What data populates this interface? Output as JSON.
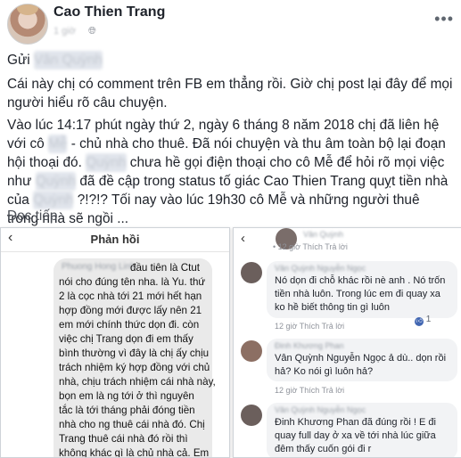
{
  "header": {
    "author": "Cao Thien Trang",
    "time": "1 giờ",
    "globe_icon": "globe-icon",
    "more_label": "•••"
  },
  "post": {
    "greeting": "Gửi",
    "greeting_name": "Vân Quỳnh",
    "para1": "Cái này chị có comment trên FB em thẳng rồi. Giờ chị post lại đây để mọi người hiểu rõ câu chuyện.",
    "para2_a": "Vào lúc 14:17 phút ngày thứ 2, ngày 6 tháng 8 năm 2018 chị đã liên hệ với cô",
    "hidden_1": "Mễ",
    "para2_b": "- chủ nhà cho thuê. Đã nói chuyện và thu âm toàn bộ lại đoạn hội thoại đó.",
    "hidden_2": "Quỳnh",
    "para2_c": "chưa hề gọi điện thoại cho cô Mễ để hỏi rõ mọi việc như",
    "hidden_3": "Quỳnh",
    "para2_d": "đã đề cập trong status tố giác Cao Thien Trang quỵt tiền nhà của",
    "hidden_4": "Quỳnh",
    "para2_e": "?!?!? Tối nay vào lúc 19h30 cô Mễ và những người thuê trong nhà sẽ ngồi ...",
    "see_more": "Đọc tiếp"
  },
  "left_shot": {
    "title": "Phản hồi",
    "back_label": "‹",
    "sender": "Phuong Hong Linh",
    "lines": [
      "đầu tiên là Ctut",
      "nói cho đúng tên nha. là Yu. thứ",
      "2 là cọc nhà tới 21 mới hết hạn",
      "hợp đồng mới được lấy nên 21",
      "em mới chính thức dọn đi. còn",
      "việc chị Trang dọn đi em thấy",
      "bình thường vì đây là chị ấy chịu",
      "trách nhiệm ký hợp đồng với chủ",
      "nhà, chịu trách nhiệm cái nhà này,",
      "bọn em là ng tới ở thì nguyên",
      "tắc là tới tháng phải đóng tiền",
      "nhà cho ng thuê cái nhà đó. Chị",
      "Trang thuê cái nhà đó rồi thì",
      "không khác gì là chủ nhà cả. Em",
      "chỉ thuê lại nhà thôi. em chỉ biết",
      "trách nhiệm của em là hết tháng"
    ]
  },
  "right_shot": {
    "back_label": "‹",
    "top_name": "Vân Quỳnh",
    "top_actions": "• 12 giờ   Thích   Trả lời",
    "comments": [
      {
        "name": "Vân Quỳnh Nguyễn Ngọc",
        "lines": [
          "Nó dọn đi chỗ khác rồi nè anh . Nó trốn",
          "tiền nhà luôn. Trong lúc em đi quay xa",
          "ko hề biết thông tin gì luôn"
        ],
        "actions": "12 giờ   Thích   Trả lời",
        "reactions": "1"
      },
      {
        "name": "Đinh Khương Phan",
        "lines": [
          "Vân Quỳnh Nguyễn Ngọc ả dù.. dọn rồi",
          "hả? Ko nói gì luôn hả?"
        ],
        "actions": "12 giờ   Thích   Trả lời"
      },
      {
        "name": "Vân Quỳnh Nguyễn Ngọc",
        "lines": [
          "Đinh Khương Phan đã đúng rồi ! E đi",
          "quay full day ở xa về tới nhà lúc giữa",
          "đêm thấy cuốn gói đi r"
        ],
        "actions": "12 giờ   Thích   Trả lời"
      }
    ]
  }
}
